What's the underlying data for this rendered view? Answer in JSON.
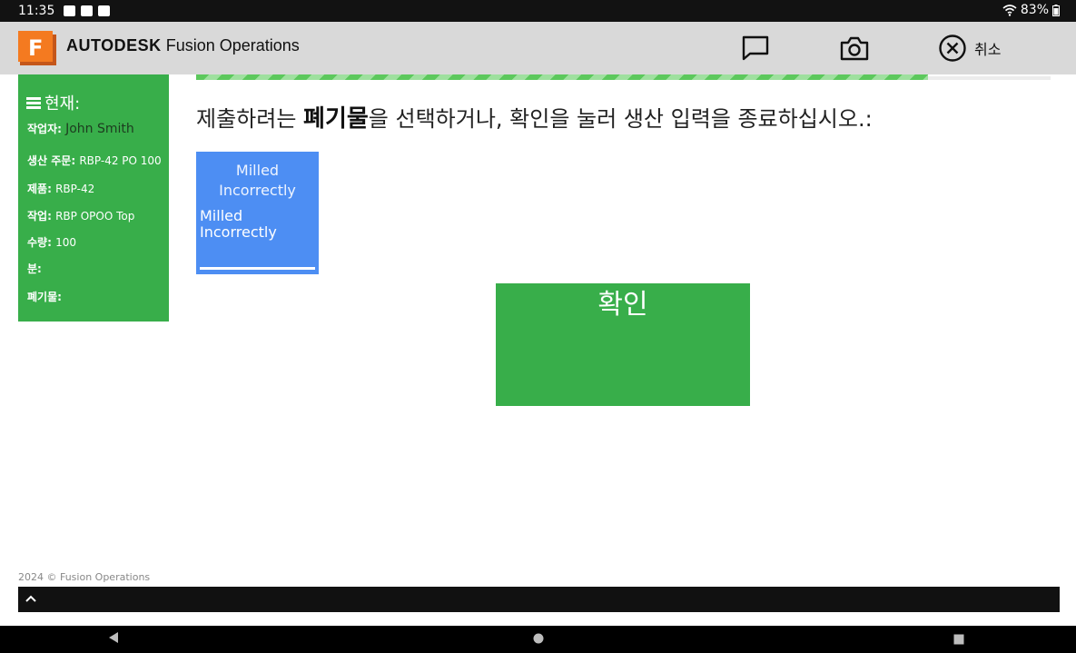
{
  "status_bar": {
    "time": "11:35",
    "battery": "83%"
  },
  "app_bar": {
    "logo_letter": "F",
    "brand_bold": "AUTODESK",
    "brand_name": "Fusion Operations",
    "cancel_label": "취소"
  },
  "sidebar": {
    "header": "현재:",
    "rows": [
      {
        "label": "작업자:",
        "value": "John Smith"
      },
      {
        "label": "생산 주문:",
        "value": "RBP-42 PO 100"
      },
      {
        "label": "제품:",
        "value": "RBP-42"
      },
      {
        "label": "작업:",
        "value": "RBP OPOO Top"
      },
      {
        "label": "수량:",
        "value": "100"
      },
      {
        "label": "분:",
        "value": ""
      },
      {
        "label": "폐기물:",
        "value": ""
      }
    ]
  },
  "main": {
    "instruction_pre": "제출하려는 ",
    "instruction_bold": "폐기물",
    "instruction_post": "을 선택하거나, 확인을 눌러 생산 입력을 종료하십시오.:",
    "waste_tile": {
      "title": "Milled Incorrectly",
      "label": "Milled Incorrectly"
    },
    "confirm_label": "확인"
  },
  "footer": {
    "copyright": "2024 © Fusion Operations"
  },
  "colors": {
    "green": "#38ae4a",
    "blue": "#4d8ef3",
    "appbar": "#d9d9d9",
    "logo_orange": "#f47a20"
  }
}
